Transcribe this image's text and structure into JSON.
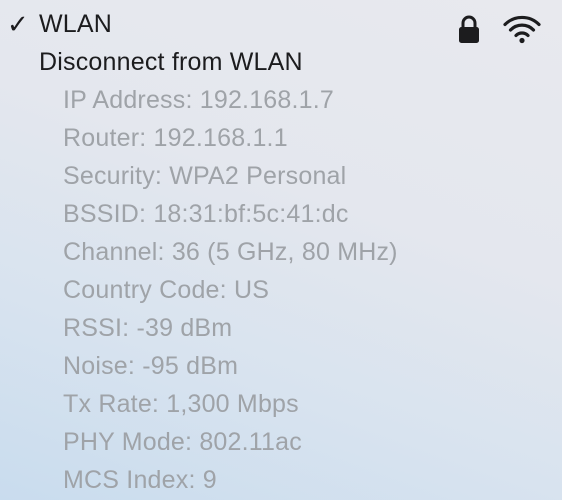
{
  "network": {
    "check_mark": "✓",
    "name": "WLAN",
    "lock_icon": "lock-icon",
    "wifi_icon": "wifi-icon",
    "disconnect_label": "Disconnect from WLAN"
  },
  "details": [
    "IP Address: 192.168.1.7",
    "Router: 192.168.1.1",
    "Security: WPA2 Personal",
    "BSSID: 18:31:bf:5c:41:dc",
    "Channel: 36 (5 GHz, 80 MHz)",
    "Country Code: US",
    "RSSI: -39 dBm",
    "Noise: -95 dBm",
    "Tx Rate: 1,300 Mbps",
    "PHY Mode: 802.11ac",
    "MCS Index: 9"
  ],
  "colors": {
    "primary_text": "#1c1c1e",
    "secondary_text": "#9fa3a8"
  }
}
